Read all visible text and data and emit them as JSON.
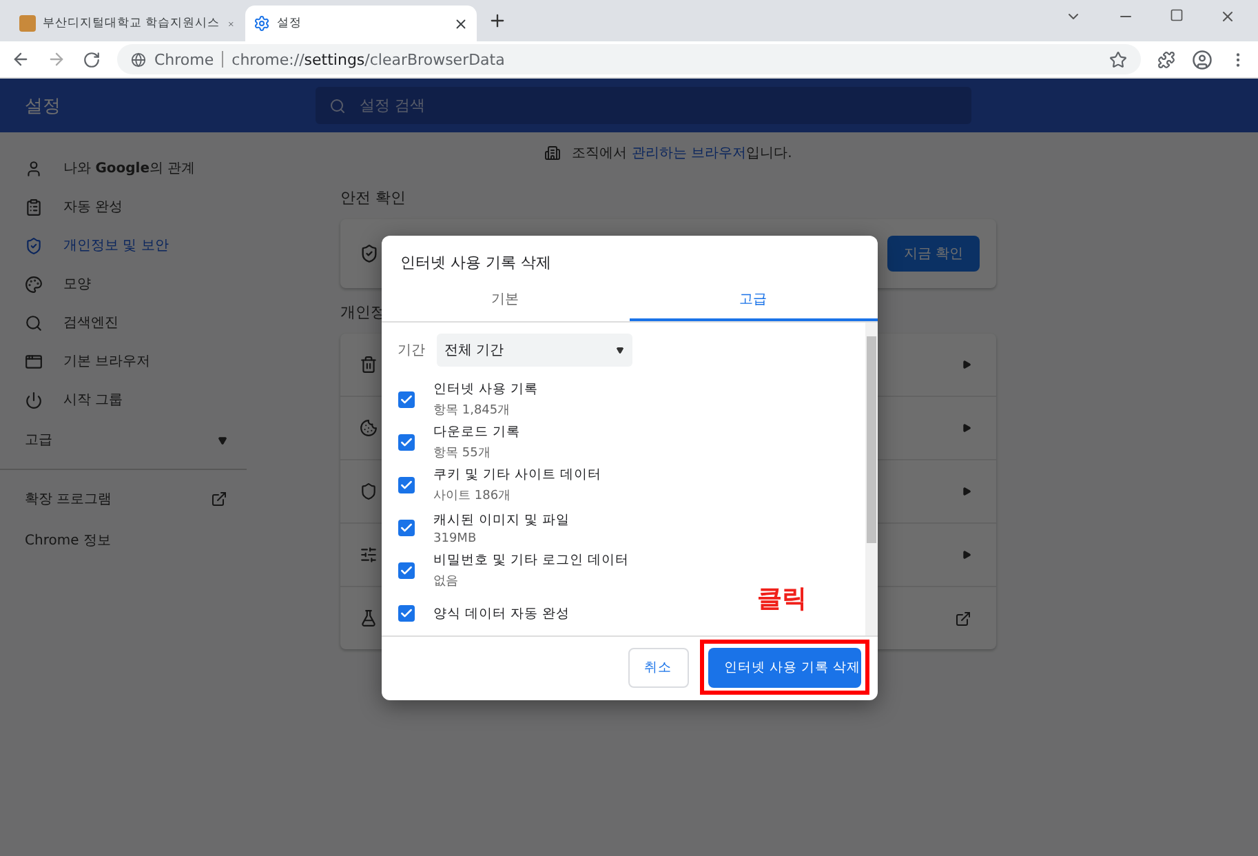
{
  "browser": {
    "tabs": [
      {
        "title": "부산디지털대학교 학습지원시스",
        "kind": "site",
        "selected": false
      },
      {
        "title": "설정",
        "kind": "settings",
        "selected": true
      }
    ],
    "address": {
      "site_label": "Chrome",
      "url": "chrome://**settings**/clearBrowserData"
    }
  },
  "header": {
    "title": "설정",
    "search_placeholder": "설정 검색"
  },
  "sidebar": {
    "items": [
      {
        "label": "나와 **Google**의 관계",
        "kind": "person",
        "selected": false
      },
      {
        "label": "자동 완성",
        "kind": "clipboard",
        "selected": false
      },
      {
        "label": "개인정보 및 보안",
        "kind": "shield",
        "selected": true
      },
      {
        "label": "모양",
        "kind": "palette",
        "selected": false
      },
      {
        "label": "검색엔진",
        "kind": "search",
        "selected": false
      },
      {
        "label": "기본 브라우저",
        "kind": "browser",
        "selected": false
      },
      {
        "label": "시작 그룹",
        "kind": "power",
        "selected": false
      }
    ],
    "advanced": "고급",
    "extensions": "확장 프로그램",
    "about": "Chrome 정보"
  },
  "content": {
    "managed_notice": {
      "before": "조직에서 ",
      "link": "관리하는 브라우저",
      "after": "입니다."
    },
    "safety_check": {
      "heading": "안전 확인",
      "button": "지금 확인"
    },
    "privacy_heading": "개인정",
    "privacy_rows": [
      {
        "kind": "trash",
        "external": false
      },
      {
        "kind": "cookie",
        "external": false
      },
      {
        "kind": "shield",
        "external": false
      },
      {
        "kind": "sliders",
        "external": false
      },
      {
        "kind": "flask",
        "external": true
      }
    ]
  },
  "dialog": {
    "title": "인터넷 사용 기록 삭제",
    "tabs": [
      {
        "label": "기본",
        "selected": false
      },
      {
        "label": "고급",
        "selected": true
      }
    ],
    "time_range": {
      "label": "기간",
      "value": "전체 기간"
    },
    "items": [
      {
        "title": "인터넷 사용 기록",
        "detail": "항목 1,845개",
        "checked": true
      },
      {
        "title": "다운로드 기록",
        "detail": "항목 55개",
        "checked": true
      },
      {
        "title": "쿠키 및 기타 사이트 데이터",
        "detail": "사이트 186개",
        "checked": true
      },
      {
        "title": "캐시된 이미지 및 파일",
        "detail": "319MB",
        "checked": true
      },
      {
        "title": "비밀번호 및 기타 로그인 데이터",
        "detail": "없음",
        "checked": true
      },
      {
        "title": "양식 데이터 자동 완성",
        "checked": true
      }
    ],
    "cancel": "취소",
    "confirm": "인터넷 사용 기록 삭제"
  },
  "annotation": {
    "label": "클릭"
  }
}
